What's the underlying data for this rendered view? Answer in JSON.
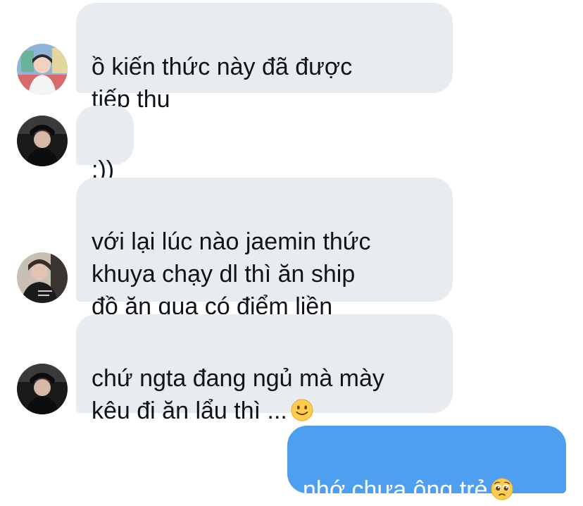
{
  "messages": [
    {
      "sender": "other-1",
      "text": "ồ kiến thức này đã được\ntiếp thu"
    },
    {
      "sender": "other-2",
      "text": ":))"
    },
    {
      "sender": "other-3",
      "text": "với lại lúc nào jaemin thức\nkhuya chạy dl thì ăn ship\nđồ ăn qua có điểm liền"
    },
    {
      "sender": "other-2",
      "text": "chứ ngta đang ngủ mà mày\nkêu đi ăn lẩu thì ...",
      "emoji": "slightly-smiling-face-icon"
    },
    {
      "sender": "me",
      "text": "nhớ chưa ông trẻ",
      "emoji": "pleading-face-icon"
    }
  ],
  "colors": {
    "incoming_bubble": "#e8ebef",
    "outgoing_bubble": "#4f9ff0",
    "text": "#0f1419"
  }
}
